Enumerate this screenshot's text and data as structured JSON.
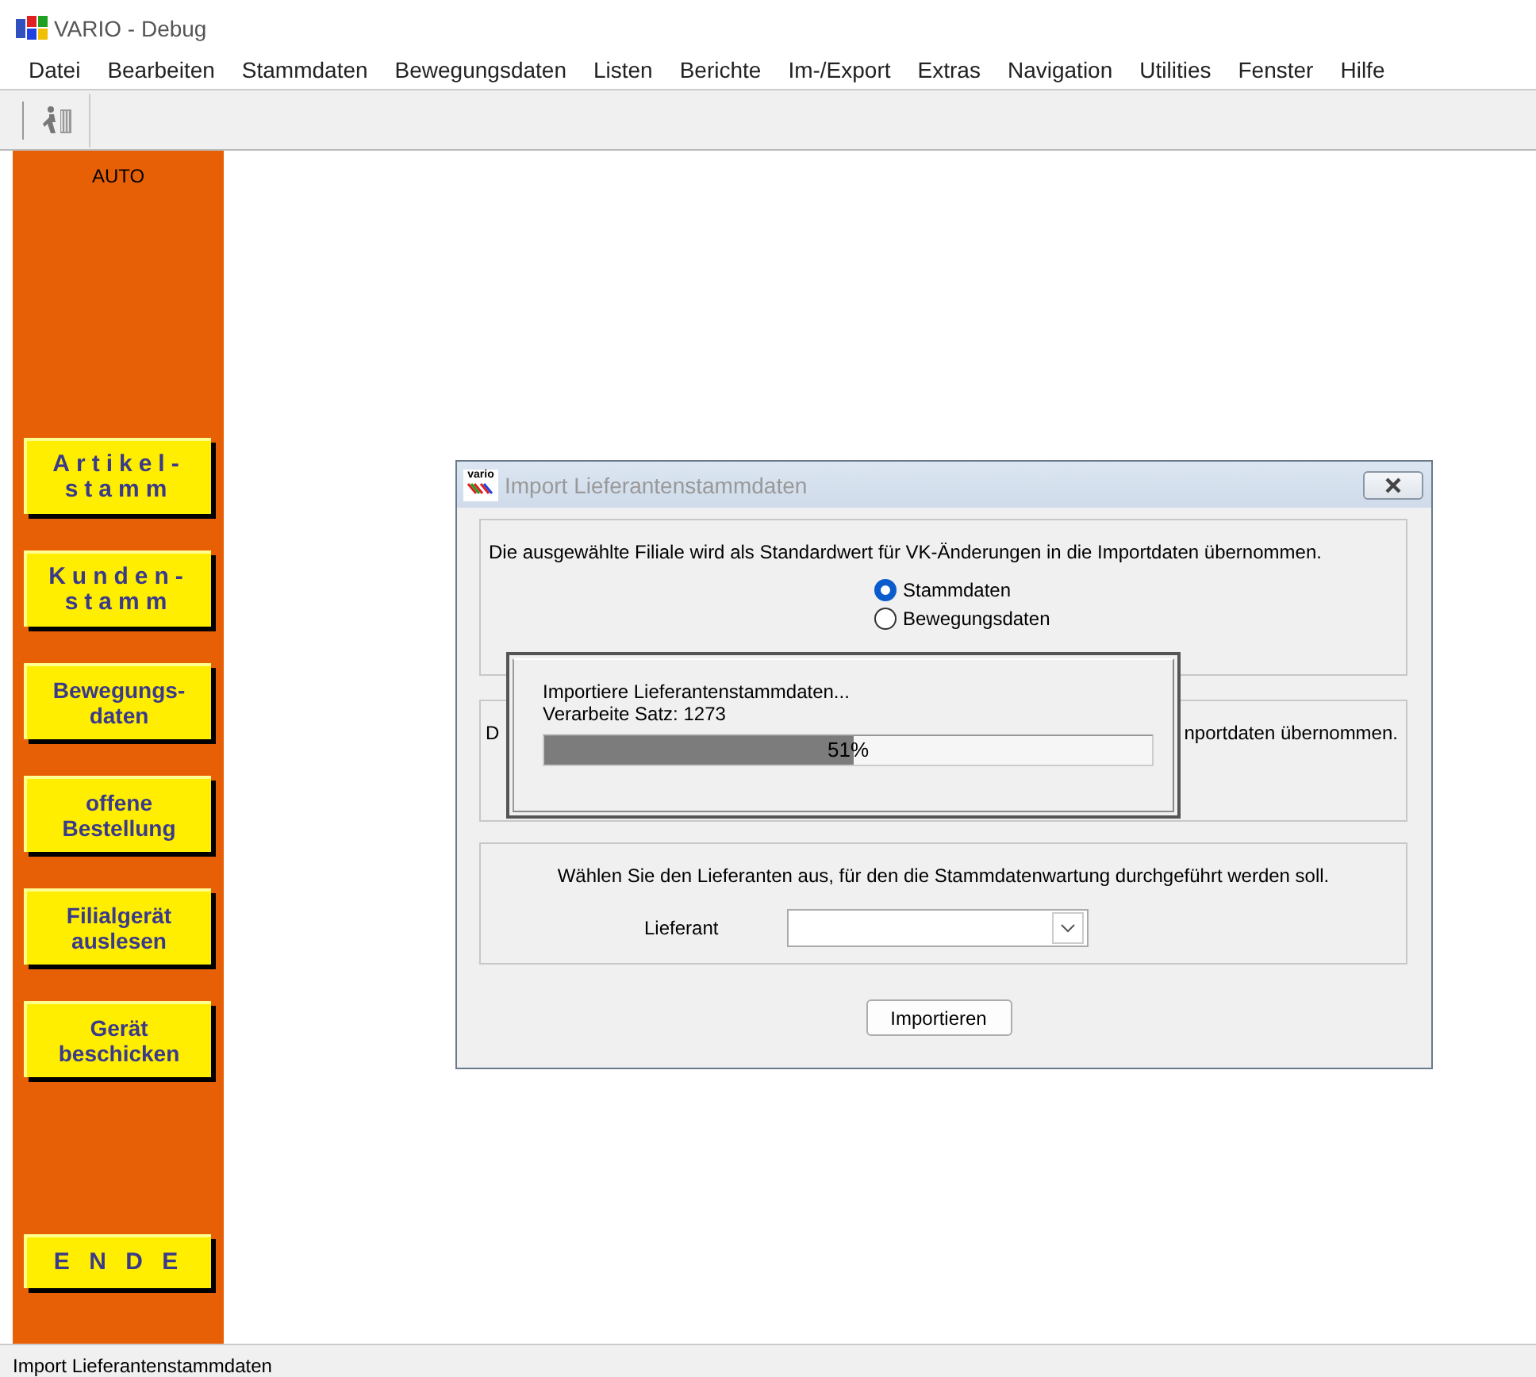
{
  "window": {
    "title": "VARIO - Debug"
  },
  "menu": [
    "Datei",
    "Bearbeiten",
    "Stammdaten",
    "Bewegungsdaten",
    "Listen",
    "Berichte",
    "Im-/Export",
    "Extras",
    "Navigation",
    "Utilities",
    "Fenster",
    "Hilfe"
  ],
  "sidebar": {
    "label": "AUTO",
    "buttons": [
      {
        "lines": [
          "Artikel-",
          "stamm"
        ],
        "kind": "spaced"
      },
      {
        "lines": [
          "Kunden-",
          "stamm"
        ],
        "kind": "spaced"
      },
      {
        "lines": [
          "Bewegungs-",
          "daten"
        ],
        "kind": "normal"
      },
      {
        "lines": [
          "offene",
          "Bestellung"
        ],
        "kind": "normal"
      },
      {
        "lines": [
          "Filialgerät",
          "auslesen"
        ],
        "kind": "normal"
      },
      {
        "lines": [
          "Gerät",
          "beschicken"
        ],
        "kind": "normal"
      }
    ],
    "exit_button": {
      "lines": [
        "E N D E"
      ],
      "kind": "spaced"
    }
  },
  "dialog": {
    "logo": "vario",
    "title": "Import Lieferantenstammdaten",
    "group_1": {
      "text": "Die ausgewählte Filiale wird als Standardwert für VK-Änderungen in die Importdaten übernommen.",
      "radios": [
        {
          "label": "Stammdaten",
          "selected": true
        },
        {
          "label": "Bewegungsdaten",
          "selected": false
        }
      ]
    },
    "group_2": {
      "text_left": "D",
      "text_right": "nportdaten übernommen."
    },
    "group_3": {
      "text": "Wählen Sie den Lieferanten aus, für den die Stammdatenwartung durchgeführt werden soll.",
      "field_label": "Lieferant"
    },
    "button": "Importieren"
  },
  "progress": {
    "lines": [
      "Importiere Lieferantenstammdaten...",
      "Verarbeite Satz: 1273"
    ],
    "level": 0.51,
    "reading": "51%"
  },
  "status_bar": "Import Lieferantenstammdaten"
}
